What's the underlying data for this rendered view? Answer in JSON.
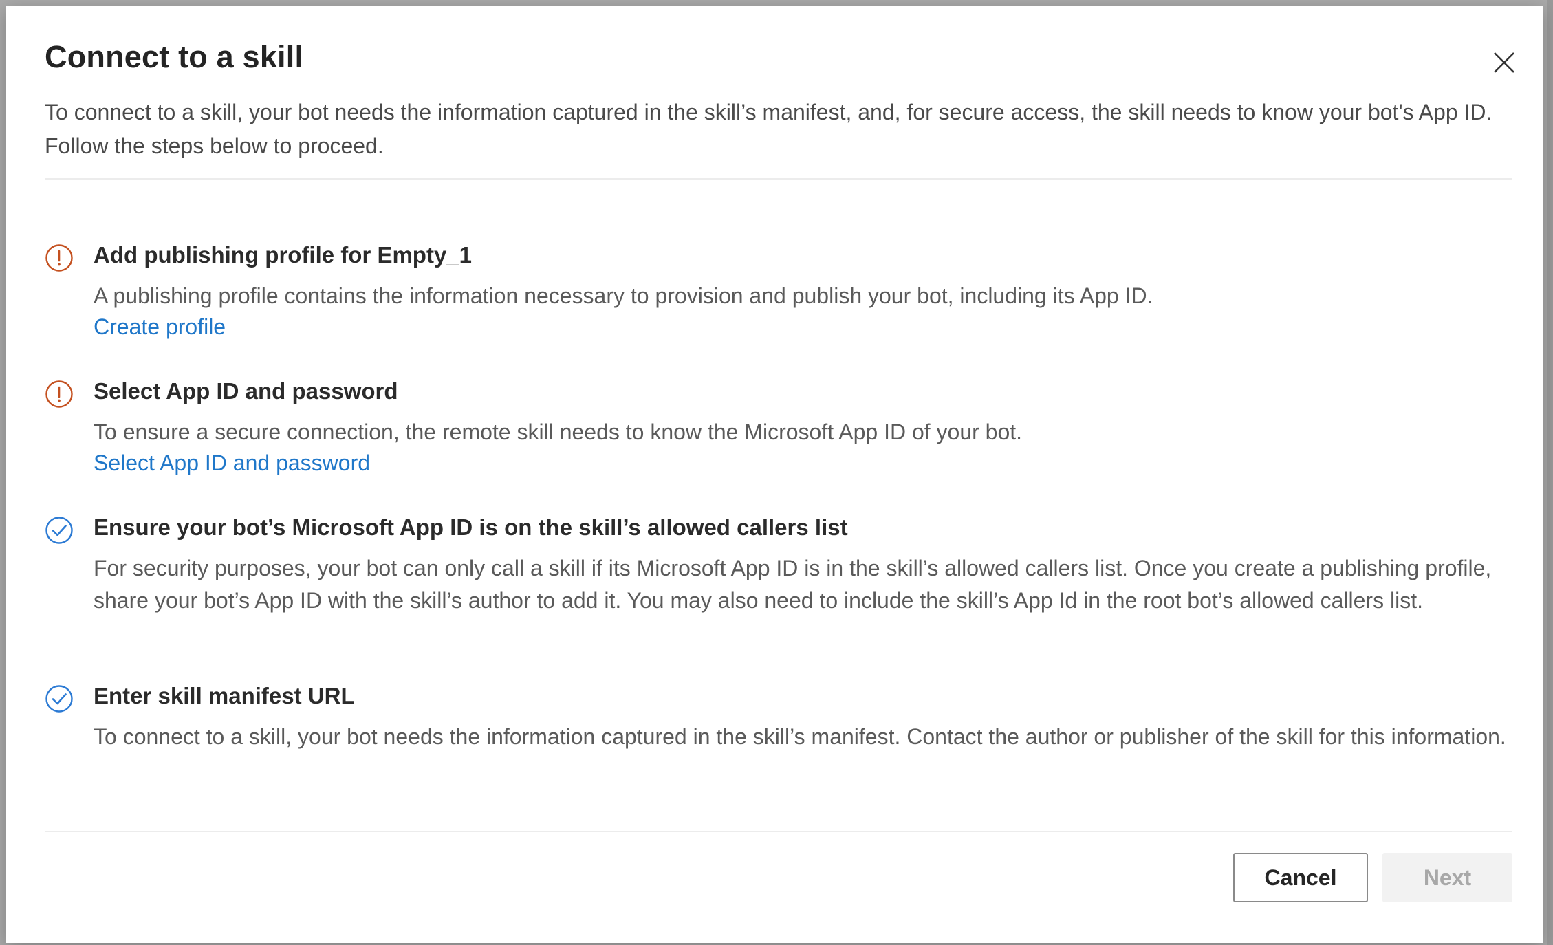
{
  "dialog": {
    "title": "Connect to a skill",
    "intro": "To connect to a skill, your bot needs the information captured in the skill’s manifest, and, for secure access, the skill needs to know your bot's App ID. Follow the steps below to proceed."
  },
  "steps": [
    {
      "status": "warning",
      "icon": "warning-circle-icon",
      "title": "Add publishing profile for Empty_1",
      "description": "A publishing profile contains the information necessary to provision and publish your bot, including its App ID.",
      "link": "Create profile"
    },
    {
      "status": "warning",
      "icon": "warning-circle-icon",
      "title": "Select App ID and password",
      "description": "To ensure a secure connection, the remote skill needs to know the Microsoft App ID of your bot.",
      "link": "Select App ID and password"
    },
    {
      "status": "complete",
      "icon": "check-circle-icon",
      "title": "Ensure your bot’s Microsoft App ID is on the skill’s allowed callers list",
      "description": "For security purposes, your bot can only call a skill if its Microsoft App ID is in the skill’s allowed callers list. Once you create a publishing profile, share your bot’s App ID with the skill’s author to add it. You may also need to include the skill’s App Id in the root bot’s allowed callers list."
    },
    {
      "status": "complete",
      "icon": "check-circle-icon",
      "title": "Enter skill manifest URL",
      "description": "To connect to a skill, your bot needs the information captured in the skill’s manifest. Contact the author or publisher of the skill for this information."
    }
  ],
  "footer": {
    "cancel_label": "Cancel",
    "next_label": "Next",
    "next_enabled": false
  },
  "colors": {
    "warning": "#c4501f",
    "complete": "#2b7ad4",
    "link": "#1f77c9"
  }
}
